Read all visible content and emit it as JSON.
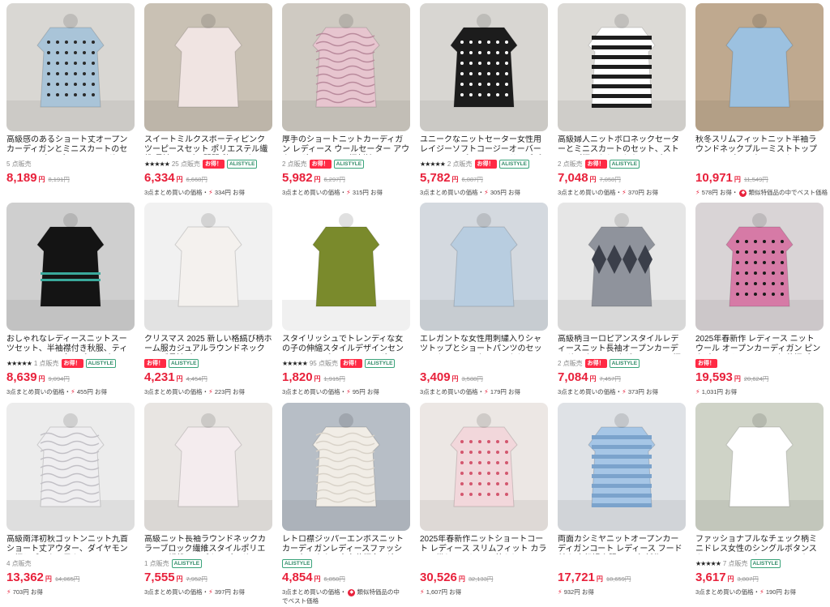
{
  "products": [
    {
      "title": "高級感のあるショート丈オープンカーディガンとミニスカートのセットアップ レディース エレガント...",
      "sold": "5 点販売",
      "price": "8,189",
      "yen": "円",
      "old_price": "8,191円",
      "savings": ""
    },
    {
      "title": "スイートミルクスポーティピンクツーピースセット ポリエステル繊維 長袖ジッパー開閉 秋コレクシ...",
      "stars": "★★★★★",
      "sold": "25 点販売",
      "otoku": "お得！",
      "store": "ALISTYLE",
      "price": "6,334",
      "yen": "円",
      "old_price": "6,668円",
      "savings_prefix": "3点まとめ買いの価格・",
      "savings_bolt": "⚡",
      "savings": "334円 お得"
    },
    {
      "title": "厚手のショートニットカーディガン レディース ウールセーター アウター ダイヤモンド柄刺繍 スイー...",
      "sold": "2 点販売",
      "otoku": "お得！",
      "store": "ALISTYLE",
      "price": "5,982",
      "yen": "円",
      "old_price": "6,297円",
      "savings_prefix": "3点まとめ買いの価格・",
      "savings_bolt": "⚡",
      "savings": "315円 お得"
    },
    {
      "title": "ユニークなニットセーター女性用レイジーソフトコージーオーバーヘッドトップススモールサイズプリッ...",
      "stars": "★★★★★",
      "sold": "2 点販売",
      "otoku": "お得！",
      "store": "ALISTYLE",
      "price": "5,782",
      "yen": "円",
      "old_price": "6,087円",
      "savings_prefix": "3点まとめ買いの価格・",
      "savings_bolt": "⚡",
      "savings": "305円 お得"
    },
    {
      "title": "高級婦人ニットボロネックセーターとミニスカートのセット、ストライプ柄のおしゃれなツーピース、...",
      "sold": "2 点販売",
      "otoku": "お得！",
      "store": "ALISTYLE",
      "price": "7,048",
      "yen": "円",
      "old_price": "7,058円",
      "savings_prefix": "3点まとめ買いの価格・",
      "savings_bolt": "⚡",
      "savings": "370円 お得"
    },
    {
      "title": "秋冬スリムフィットニット半袖ラウンドネックプルーミストトップスとラップアラウンドスカートのツー...",
      "sold": "",
      "price": "10,971",
      "yen": "円",
      "old_price": "11,549円",
      "savings_prefix": "",
      "savings_bolt": "⚡",
      "savings": "578円 お得・",
      "extra": "類似特価品の中でベスト価格"
    },
    {
      "title": "おしゃれなレディースニットスーツセット、半袖襟付き秋服、ティーンエイジャー女子プレッピー...",
      "stars": "★★★★★",
      "sold": "1 点販売",
      "otoku": "お得！",
      "store": "ALISTYLE",
      "price": "8,639",
      "yen": "円",
      "old_price": "9,094円",
      "savings_prefix": "3点まとめ買いの価格・",
      "savings_bolt": "⚡",
      "savings": "455円 お得"
    },
    {
      "title": "クリスマス 2025 新しい格縞び柄ホーム服カジュアルラウンドネックルーズ長袖パジャマセット...",
      "sold": "",
      "otoku": "お得！",
      "store": "ALISTYLE",
      "price": "4,231",
      "yen": "円",
      "old_price": "4,454円",
      "savings_prefix": "3点まとめ買いの価格・",
      "savings_bolt": "⚡",
      "savings": "223円 お得"
    },
    {
      "title": "スタイリッシュでトレンディな女の子の伸縮スタイルデザインセンスストラップレススリミングエレガ...",
      "stars": "★★★★★",
      "sold": "95 点販売",
      "otoku": "お得！",
      "store": "ALISTYLE",
      "price": "1,820",
      "yen": "円",
      "old_price": "1,915円",
      "savings_prefix": "3点まとめ買いの価格・",
      "savings_bolt": "⚡",
      "savings": "95円 お得"
    },
    {
      "title": "エレガントな女性用刺繍入りシャツトップとショートパンツのセット、カレッジスタイルのおしゃれ...",
      "sold": "",
      "price": "3,409",
      "yen": "円",
      "old_price": "3,588円",
      "savings_prefix": "3点まとめ買いの価格・",
      "savings_bolt": "⚡",
      "savings": "179円 お得"
    },
    {
      "title": "高級柄ヨーロピアンスタイルレディースニット長袖オープンカーディガン クラシックダイヤモンド柄カ...",
      "sold": "2 点販売",
      "otoku": "お得！",
      "store": "ALISTYLE",
      "price": "7,084",
      "yen": "円",
      "old_price": "7,457円",
      "savings_prefix": "3点まとめ買いの価格・",
      "savings_bolt": "⚡",
      "savings": "373円 お得"
    },
    {
      "title": "2025年春新作 レディース ニット ウール オープンカーディガン ピンクパールチェーンフック 花柄デ...",
      "sold": "",
      "otoku": "お得！",
      "price": "19,593",
      "yen": "円",
      "old_price": "20,624円",
      "savings_prefix": "",
      "savings_bolt": "⚡",
      "savings": "1,031円 お得"
    },
    {
      "title": "高級南洋初秋ゴットンニット九首ショート丈アウター、ダイヤモンド柄とブークレ風カジュアルニ...",
      "sold": "4 点販売",
      "price": "13,362",
      "yen": "円",
      "old_price": "14,065円",
      "savings_prefix": "",
      "savings_bolt": "⚡",
      "savings": "703円 お得"
    },
    {
      "title": "高級ニット長袖ラウンドネックカラーブロック繊維スタイルポリエステル繊維メンズカーディガン...",
      "sold": "1 点販売",
      "store": "ALISTYLE",
      "price": "7,555",
      "yen": "円",
      "old_price": "7,952円",
      "savings_prefix": "3点まとめ買いの価格・",
      "savings_bolt": "⚡",
      "savings": "397円 お得"
    },
    {
      "title": "レトロ襟ジッパーエンボスニットカーディガンレディースファッション冬アウター中空花柄多用途...",
      "sold": "",
      "store": "ALISTYLE",
      "price": "4,854",
      "yen": "円",
      "old_price": "6,850円",
      "savings_prefix": "3点まとめ買いの価格・",
      "savings_bolt": "",
      "savings": "",
      "extra": "類似特価品の中でベスト価格"
    },
    {
      "title": "2025年春新作ニットショートコート レディース スリムフィット カラフル織りジャケット 着々しい...",
      "sold": "",
      "price": "30,526",
      "yen": "円",
      "old_price": "32,133円",
      "savings_prefix": "",
      "savings_bolt": "⚡",
      "savings": "1,607円 お得"
    },
    {
      "title": "両面カシミヤニットオープンカーディガンコート レディース フード付き 高級婦人服 2025年新作...",
      "sold": "",
      "price": "17,721",
      "yen": "円",
      "old_price": "18,659円",
      "savings_prefix": "",
      "savings_bolt": "⚡",
      "savings": "932円 お得"
    },
    {
      "title": "ファッショナブルなチェック柄ミニドレス女性のシングルボタンスカートドレススタイリッシュな A ライ...",
      "stars": "★★★★★",
      "sold": "7 点販売",
      "store": "ALISTYLE",
      "price": "3,617",
      "yen": "円",
      "old_price": "3,807円",
      "savings_prefix": "3点まとめ買いの価格・",
      "savings_bolt": "⚡",
      "savings": "190円 お得"
    }
  ],
  "colors": {
    "price": "#e8213b",
    "badge": "#ff2a44",
    "store_badge": "#2f8a66"
  }
}
